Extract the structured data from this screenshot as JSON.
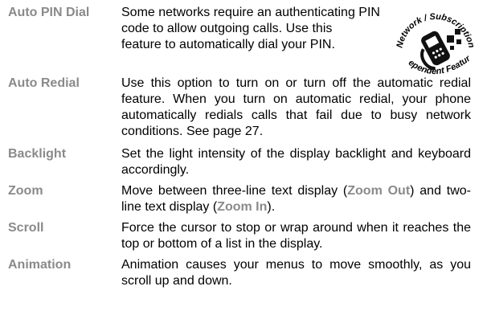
{
  "entries": [
    {
      "term": "Auto PIN Dial",
      "lines": [
        "Some networks require an authenticating PIN",
        "code to allow outgoing calls. Use this",
        "feature to automatically dial your PIN."
      ]
    },
    {
      "term": "Auto Redial",
      "text": "Use this option to turn on or turn off the automatic redial feature. When you turn on automatic redial, your phone automatically redials calls that fail due to busy network conditions. See page 27."
    },
    {
      "term": "Backlight",
      "text": "Set the light intensity of the display backlight and keyboard accordingly."
    },
    {
      "term": "Zoom",
      "parts": [
        "Move between three-line text display (",
        "Zoom Out",
        ") and two-line text display (",
        "Zoom In",
        ")."
      ]
    },
    {
      "term": "Scroll",
      "text": "Force the cursor to stop or wrap around when it reaches the top or bottom of a list in the display."
    },
    {
      "term": "Animation",
      "text": "Animation causes your menus to move smoothly, as you scroll up and down."
    }
  ],
  "badge": {
    "icon": "network-subscription-phone-icon",
    "top_text": "Network / Subscription",
    "bottom_text": "Dependent Feature"
  }
}
